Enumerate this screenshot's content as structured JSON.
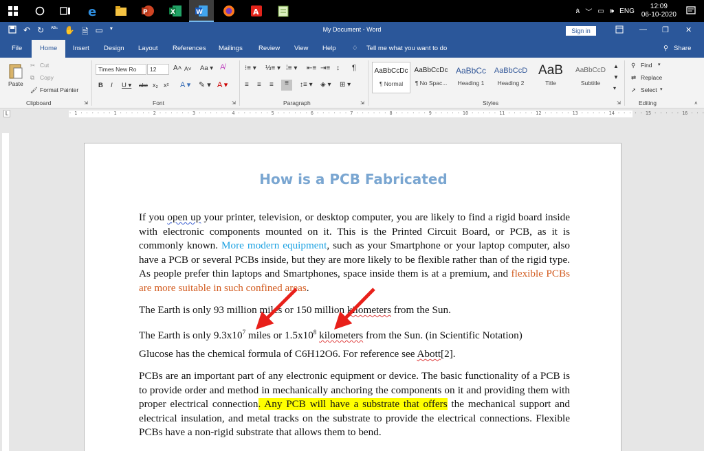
{
  "taskbar": {
    "network_label": "ENG",
    "time": "12:09",
    "date": "06-10-2020"
  },
  "titlebar": {
    "title": "My Document  -  Word",
    "signin": "Sign in"
  },
  "tabs": [
    "File",
    "Home",
    "Insert",
    "Design",
    "Layout",
    "References",
    "Mailings",
    "Review",
    "View",
    "Help"
  ],
  "tell_me": "Tell me what you want to do",
  "share": "Share",
  "ribbon": {
    "clipboard": {
      "paste": "Paste",
      "cut": "Cut",
      "copy": "Copy",
      "format_painter": "Format Painter",
      "label": "Clipboard"
    },
    "font": {
      "name": "Times New Ro",
      "size": "12",
      "label": "Font"
    },
    "paragraph": {
      "label": "Paragraph"
    },
    "styles": {
      "label": "Styles",
      "items": [
        {
          "preview": "AaBbCcDc",
          "name": "¶ Normal"
        },
        {
          "preview": "AaBbCcDc",
          "name": "¶ No Spac..."
        },
        {
          "preview": "AaBbCc",
          "name": "Heading 1"
        },
        {
          "preview": "AaBbCcD",
          "name": "Heading 2"
        },
        {
          "preview": "AaB",
          "name": "Title"
        },
        {
          "preview": "AaBbCcD",
          "name": "Subtitle"
        }
      ]
    },
    "editing": {
      "find": "Find",
      "replace": "Replace",
      "select": "Select",
      "label": "Editing"
    }
  },
  "ruler": "L      · 1 · | · 1 · | · 2 · | · 3 · | · 4 · | · 5 · | · 6 · | · 7 · | · 8 · | · 9 · | · 10 · | · 11 · | · 12 · | · 13 · | · 14 · | · 15 · | · 16 · | · 17 · | · 18",
  "document": {
    "heading": "How is a PCB Fabricated",
    "p1": {
      "a": "If you ",
      "open_up": "open up",
      "b": " your printer, television, or desktop computer, you are likely to find a rigid board inside with electronic components mounted on it. This is the Printed Circuit Board, or PCB, as it is commonly known. ",
      "blue": "More modern equipment",
      "c": ", such as your Smartphone or your laptop computer, also have a PCB or several PCBs inside, but they are more likely to be flexible rather than of the rigid type. As people prefer thin laptops and Smartphones, space inside them is at a premium, and ",
      "orange": "flexible PCBs are more suitable in such confined areas",
      "d": "."
    },
    "p2": {
      "a": "The Earth is only 93 million miles or 150 million ",
      "km": "kilometers",
      "b": " from the Sun."
    },
    "p3": {
      "a": "The Earth is only 9.3x10",
      "exp1": "7",
      "b": " miles or 1.5x10",
      "exp2": "8",
      "km": "kilometers",
      "c": " from the Sun. (in Scientific Notation)"
    },
    "p4": {
      "a": "Glucose has the chemical formula of C6H12O6. For reference see ",
      "abott": "Abott",
      "b": "[2]."
    },
    "p5": {
      "a": "PCBs are an important part of any electronic equipment or device. The basic functionality of a PCB is to provide order and method in mechanically anchoring the components on it and providing them with proper electrical connection",
      "hl": ". Any PCB will have a substrate that offers",
      "b": " the mechanical support and electrical insulation, and metal tracks on the substrate to provide the electrical connections. Flexible PCBs have a non-rigid substrate that allows them to bend."
    }
  },
  "colors": {
    "word_blue": "#2b579a",
    "heading": "#7aa6d1",
    "arrow": "#e8201a",
    "highlight": "#ffff00"
  }
}
